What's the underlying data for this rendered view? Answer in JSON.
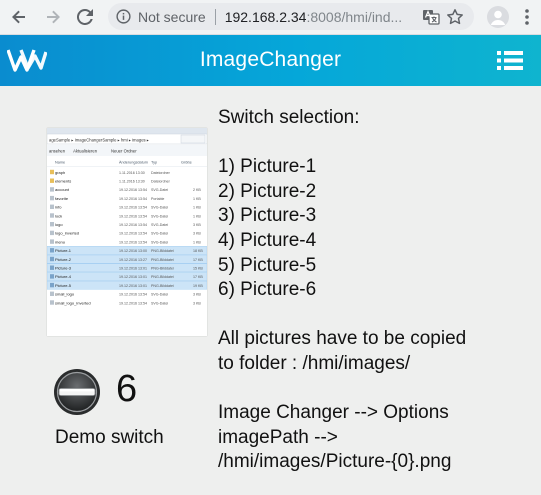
{
  "browser": {
    "security_label": "Not secure",
    "url_host": "192.168.2.34",
    "url_rest": ":8008/hmi/ind..."
  },
  "app": {
    "title": "ImageChanger",
    "accent_color": "#0a8ccf"
  },
  "thumbnail": {
    "address": "ageSample ▸ ImageChangerSample ▸ hmi ▸ images ▸",
    "toolbar": [
      "ansehen",
      "Aktualisieren",
      "Neuer Ordner"
    ],
    "columns": [
      "Name",
      "Änderungsdatum",
      "Typ",
      "Größe"
    ],
    "rows": [
      {
        "name": "graph",
        "date": "1.11.2016 13:30",
        "type": "Dateiordner",
        "size": "",
        "kind": "folder",
        "selected": false
      },
      {
        "name": "elements",
        "date": "1.11.2016 13:30",
        "type": "Dateiordner",
        "size": "",
        "kind": "folder",
        "selected": false
      },
      {
        "name": "account",
        "date": "19.12.2016 13:54",
        "type": "SVG-Datei",
        "size": "2 KB",
        "kind": "svg",
        "selected": false
      },
      {
        "name": "favorite",
        "date": "19.12.2016 13:54",
        "type": "Portable",
        "size": "1 KB",
        "kind": "svg",
        "selected": false
      },
      {
        "name": "info",
        "date": "19.12.2016 13:54",
        "type": "SVG-Datei",
        "size": "1 KB",
        "kind": "svg",
        "selected": false
      },
      {
        "name": "lock",
        "date": "19.12.2016 13:54",
        "type": "SVG-Datei",
        "size": "1 KB",
        "kind": "svg",
        "selected": false
      },
      {
        "name": "logo",
        "date": "19.12.2016 13:54",
        "type": "SVG-Datei",
        "size": "3 KB",
        "kind": "svg",
        "selected": false
      },
      {
        "name": "logo_inverted",
        "date": "19.12.2016 13:54",
        "type": "SVG-Datei",
        "size": "3 KB",
        "kind": "svg",
        "selected": false
      },
      {
        "name": "menu",
        "date": "19.12.2016 13:54",
        "type": "SVG-Datei",
        "size": "1 KB",
        "kind": "svg",
        "selected": false
      },
      {
        "name": "Picture-1",
        "date": "19.12.2016 13:00",
        "type": "PNG-Bilddatei",
        "size": "18 KB",
        "kind": "png",
        "selected": true
      },
      {
        "name": "Picture-2",
        "date": "19.12.2016 13:27",
        "type": "PNG-Bilddatei",
        "size": "17 KB",
        "kind": "png",
        "selected": true
      },
      {
        "name": "Picture-3",
        "date": "19.12.2016 13:01",
        "type": "PNG-Bilddatei",
        "size": "15 KB",
        "kind": "png",
        "selected": true
      },
      {
        "name": "Picture-4",
        "date": "19.12.2016 13:01",
        "type": "PNG-Bilddatei",
        "size": "17 KB",
        "kind": "png",
        "selected": true
      },
      {
        "name": "Picture-5",
        "date": "19.12.2016 13:01",
        "type": "PNG-Bilddatei",
        "size": "19 KB",
        "kind": "png",
        "selected": true
      },
      {
        "name": "small_logo",
        "date": "19.12.2016 13:54",
        "type": "SVG-Datei",
        "size": "3 KB",
        "kind": "svg",
        "selected": false
      },
      {
        "name": "small_logo_inverted",
        "date": "19.12.2016 13:54",
        "type": "SVG-Datei",
        "size": "3 KB",
        "kind": "svg",
        "selected": false
      }
    ]
  },
  "demo_switch": {
    "value": "6",
    "label": "Demo switch"
  },
  "info": {
    "heading": "Switch selection:",
    "options": [
      "1) Picture-1",
      "2) Picture-2",
      "3) Picture-3",
      "4) Picture-4",
      "5) Picture-5",
      "6) Picture-6"
    ],
    "copy_note_line1": "All pictures have to be copied",
    "copy_note_line2": "to folder : /hmi/images/",
    "path_line1": "Image Changer --> Options",
    "path_line2": "imagePath -->",
    "path_line3": "/hmi/images/Picture-{0}.png"
  }
}
